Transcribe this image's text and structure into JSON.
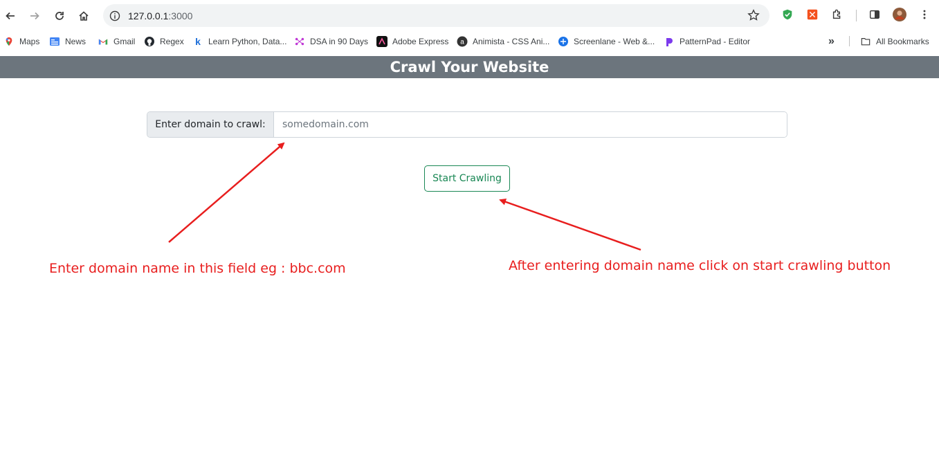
{
  "browser": {
    "url_host": "127.0.0.1",
    "url_port": ":3000",
    "bookmarks": [
      {
        "label": "Maps",
        "icon": "maps-icon"
      },
      {
        "label": "News",
        "icon": "news-icon"
      },
      {
        "label": "Gmail",
        "icon": "gmail-icon"
      },
      {
        "label": "Regex",
        "icon": "github-icon"
      },
      {
        "label": "Learn Python, Data...",
        "icon": "k-icon"
      },
      {
        "label": "DSA in 90 Days",
        "icon": "dsa-icon"
      },
      {
        "label": "Adobe Express",
        "icon": "adobe-icon"
      },
      {
        "label": "Animista - CSS Ani...",
        "icon": "animista-icon"
      },
      {
        "label": "Screenlane - Web &...",
        "icon": "screenlane-icon"
      },
      {
        "label": "PatternPad - Editor",
        "icon": "patternpad-icon"
      }
    ],
    "all_bookmarks_label": "All Bookmarks",
    "overflow_label": "»"
  },
  "page": {
    "title": "Crawl Your Website",
    "input_label": "Enter domain to crawl:",
    "input_placeholder": "somedomain.com",
    "start_button_label": "Start Crawling"
  },
  "annotations": {
    "left_note": "Enter domain name in this field eg : bbc.com",
    "right_note": "After entering domain name click on start crawling button"
  },
  "colors": {
    "header_bg": "#6c757d",
    "button_green": "#198754",
    "annotation_red": "#e81e1e"
  }
}
